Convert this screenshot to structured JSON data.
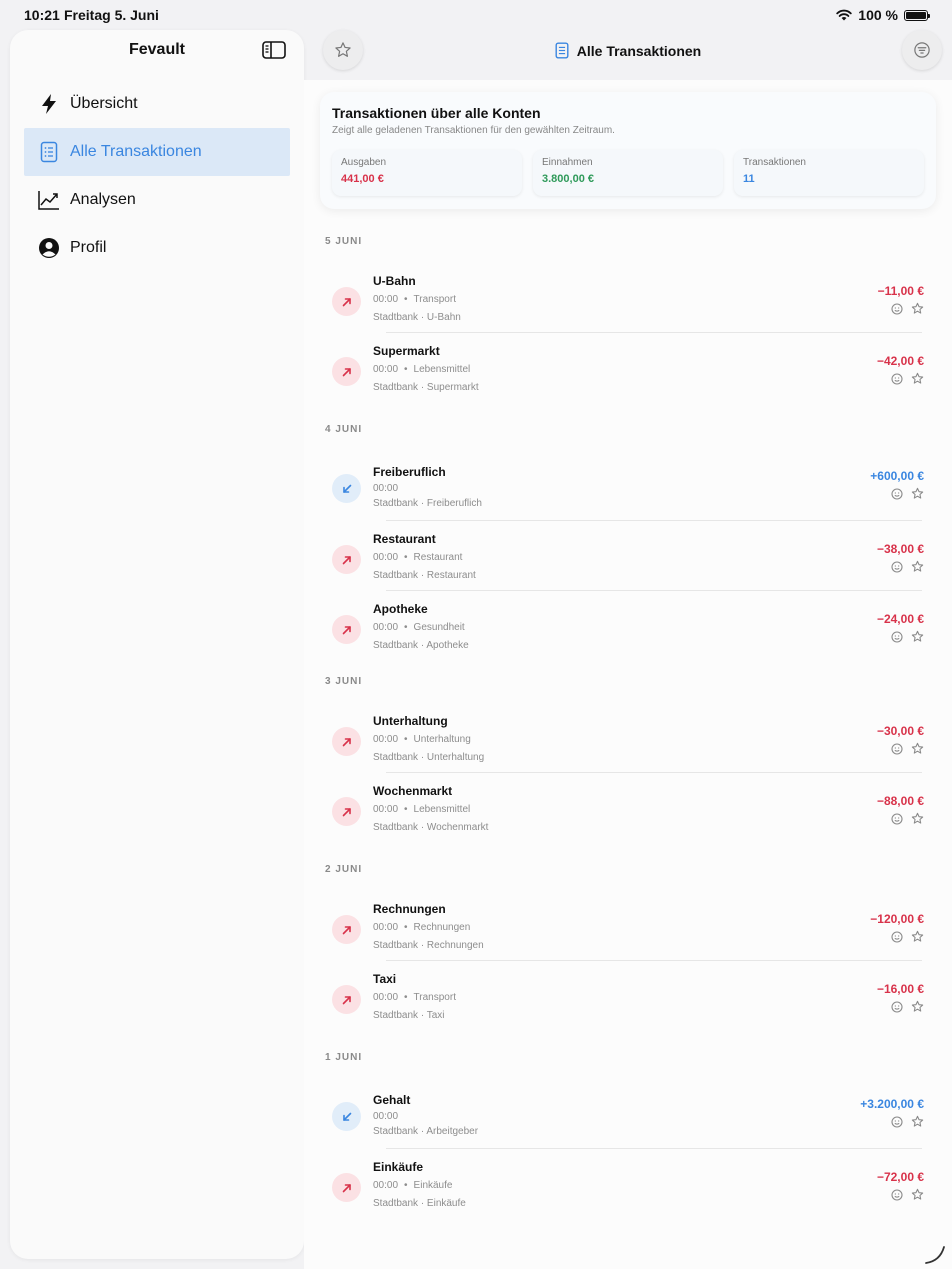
{
  "status_bar": {
    "time": "10:21",
    "date": "Freitag 5. Juni",
    "battery": "100 %",
    "battery_level": 1.0
  },
  "sidebar": {
    "title": "Fevault",
    "items": [
      {
        "label": "Übersicht",
        "icon": "bolt-icon",
        "active": false
      },
      {
        "label": "Alle Transaktionen",
        "icon": "list-document-icon",
        "active": true
      },
      {
        "label": "Analysen",
        "icon": "chart-line-icon",
        "active": false
      },
      {
        "label": "Profil",
        "icon": "person-circle-icon",
        "active": false
      }
    ]
  },
  "header": {
    "title": "Alle Transaktionen",
    "left_icon": "star-icon",
    "right_icon": "filter-icon"
  },
  "summary": {
    "title": "Transaktionen über alle Konten",
    "subtitle": "Zeigt alle geladenen Transaktionen für den gewählten Zeitraum.",
    "stats": [
      {
        "label": "Ausgaben",
        "value": "441,00 €",
        "color": "#d8324a"
      },
      {
        "label": "Einnahmen",
        "value": "3.800,00 €",
        "color": "#2f9a5a"
      },
      {
        "label": "Transaktionen",
        "value": "11",
        "color": "#3a86e0"
      }
    ]
  },
  "days": [
    {
      "label": "5 JUNI",
      "transactions": [
        {
          "name": "U-Bahn",
          "time": "00:00",
          "category": "Transport",
          "account": "Stadtbank · U-Bahn",
          "amount": "−11,00 €",
          "type": "out"
        },
        {
          "name": "Supermarkt",
          "time": "00:00",
          "category": "Lebensmittel",
          "account": "Stadtbank · Supermarkt",
          "amount": "−42,00 €",
          "type": "out"
        }
      ]
    },
    {
      "label": "4 JUNI",
      "transactions": [
        {
          "name": "Freiberuflich",
          "time": "00:00",
          "category": "",
          "account": "Stadtbank · Freiberuflich",
          "amount": "+600,00 €",
          "type": "in"
        },
        {
          "name": "Restaurant",
          "time": "00:00",
          "category": "Restaurant",
          "account": "Stadtbank · Restaurant",
          "amount": "−38,00 €",
          "type": "out"
        },
        {
          "name": "Apotheke",
          "time": "00:00",
          "category": "Gesundheit",
          "account": "Stadtbank · Apotheke",
          "amount": "−24,00 €",
          "type": "out"
        }
      ]
    },
    {
      "label": "3 JUNI",
      "transactions": [
        {
          "name": "Unterhaltung",
          "time": "00:00",
          "category": "Unterhaltung",
          "account": "Stadtbank · Unterhaltung",
          "amount": "−30,00 €",
          "type": "out"
        },
        {
          "name": "Wochenmarkt",
          "time": "00:00",
          "category": "Lebensmittel",
          "account": "Stadtbank · Wochenmarkt",
          "amount": "−88,00 €",
          "type": "out"
        }
      ]
    },
    {
      "label": "2 JUNI",
      "transactions": [
        {
          "name": "Rechnungen",
          "time": "00:00",
          "category": "Rechnungen",
          "account": "Stadtbank · Rechnungen",
          "amount": "−120,00 €",
          "type": "out"
        },
        {
          "name": "Taxi",
          "time": "00:00",
          "category": "Transport",
          "account": "Stadtbank · Taxi",
          "amount": "−16,00 €",
          "type": "out"
        }
      ]
    },
    {
      "label": "1 JUNI",
      "transactions": [
        {
          "name": "Gehalt",
          "time": "00:00",
          "category": "",
          "account": "Stadtbank · Arbeitgeber",
          "amount": "+3.200,00 €",
          "type": "in"
        },
        {
          "name": "Einkäufe",
          "time": "00:00",
          "category": "Einkäufe",
          "account": "Stadtbank · Einkäufe",
          "amount": "−72,00 €",
          "type": "out"
        }
      ]
    }
  ]
}
